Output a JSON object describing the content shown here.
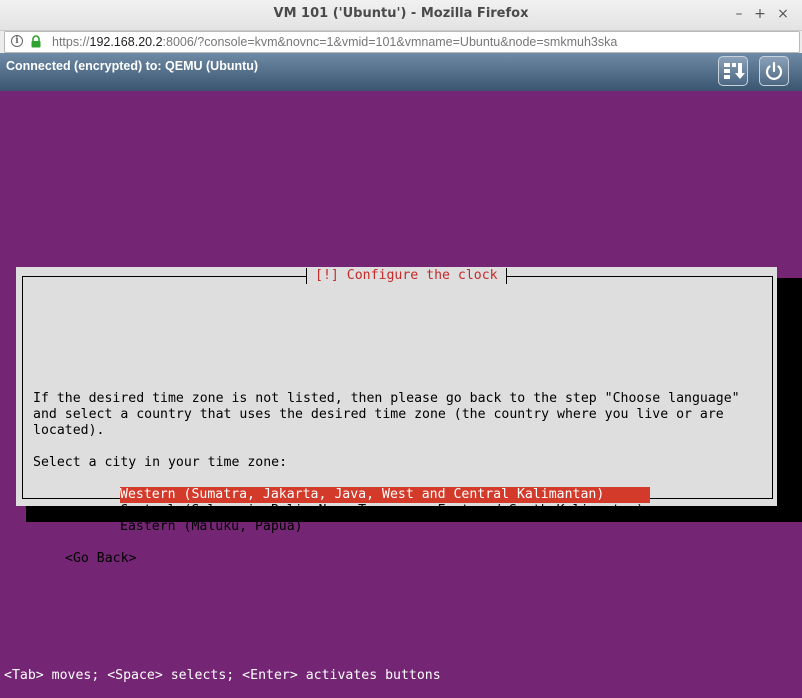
{
  "window": {
    "title": "VM 101 ('Ubuntu') - Mozilla Firefox",
    "minimize": "–",
    "maximize": "+",
    "close": "×"
  },
  "urlbar": {
    "scheme": "https://",
    "host": "192.168.20.2",
    "rest": ":8006/?console=kvm&novnc=1&vmid=101&vmname=Ubuntu&node=smkmuh3ska"
  },
  "vnc": {
    "status": "Connected (encrypted) to: QEMU (Ubuntu)",
    "buttons": [
      {
        "icon": "sendkeys-icon"
      },
      {
        "icon": "power-icon"
      }
    ]
  },
  "installer": {
    "dialog_title": "[!] Configure the clock",
    "description_lines": [
      "If the desired time zone is not listed, then please go back to the step \"Choose language\"",
      "and select a country that uses the desired time zone (the country where you live or are",
      "located)."
    ],
    "prompt": "Select a city in your time zone:",
    "options": [
      {
        "label": "Western (Sumatra, Jakarta, Java, West and Central Kalimantan)",
        "selected": true
      },
      {
        "label": "Central (Sulawesi, Bali, Nusa Tenggara, East and South Kalimantan)",
        "selected": false
      },
      {
        "label": "Eastern (Maluku, Papua)",
        "selected": false
      }
    ],
    "go_back": "<Go Back>",
    "help_line": "<Tab> moves; <Space> selects; <Enter> activates buttons"
  },
  "colors": {
    "screen_bg": "#742674",
    "dialog_bg": "#dedede",
    "title_red": "#c62a2a",
    "highlight": "#d43a2a"
  }
}
